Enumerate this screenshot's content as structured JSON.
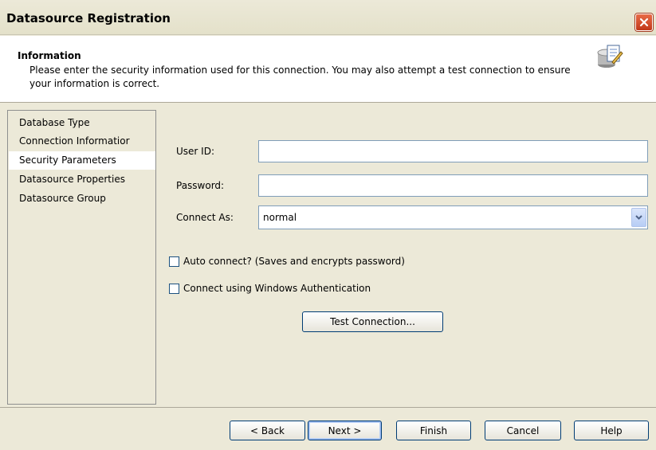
{
  "window": {
    "title": "Datasource Registration"
  },
  "header": {
    "title": "Information",
    "description": "Please enter the security information used for this connection.  You may also attempt a test connection to ensure your information is correct."
  },
  "nav": {
    "items": [
      {
        "label": "Database Type"
      },
      {
        "label": "Connection Informatior"
      },
      {
        "label": "Security Parameters",
        "selected": true
      },
      {
        "label": "Datasource Properties"
      },
      {
        "label": "Datasource Group"
      }
    ]
  },
  "form": {
    "user_id_label": "User ID:",
    "user_id_value": "",
    "password_label": "Password:",
    "password_value": "",
    "connect_as_label": "Connect As:",
    "connect_as_value": "normal",
    "auto_connect_label": "Auto connect? (Saves and encrypts password)",
    "windows_auth_label": "Connect using Windows Authentication",
    "test_connection_label": "Test Connection..."
  },
  "footer": {
    "back_label": "< Back",
    "next_label": "Next >",
    "finish_label": "Finish",
    "cancel_label": "Cancel",
    "help_label": "Help"
  },
  "icons": {
    "close": "close-icon",
    "header": "database-edit-icon",
    "dropdown": "chevron-down-icon"
  },
  "colors": {
    "accent": "#003c74",
    "close_button": "#c1381a",
    "selected_nav_bg": "#ffffff"
  }
}
